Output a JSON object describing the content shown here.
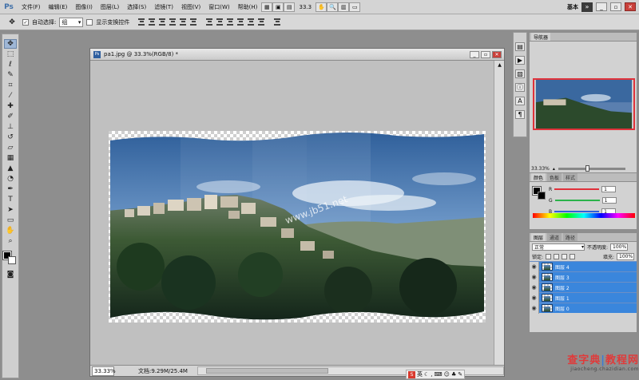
{
  "app": {
    "logo": "Ps"
  },
  "menubar": {
    "items": [
      "文件(F)",
      "编辑(E)",
      "图像(I)",
      "图层(L)",
      "选择(S)",
      "滤镜(T)",
      "视图(V)",
      "窗口(W)",
      "帮助(H)"
    ],
    "zoom": "33.3",
    "workspace": "基本"
  },
  "options": {
    "auto_select_label": "自动选择:",
    "auto_select_value": "组",
    "show_transform_label": "显示变换控件"
  },
  "document": {
    "title": "pa1.jpg @ 33.3%(RGB/8) *",
    "status_zoom": "33.33%",
    "status_info": "文档:9.29M/25.4M",
    "watermark_text": "www.jb51.net"
  },
  "panels": {
    "navigator_tab": "导航器",
    "navigator_zoom": "33.33%",
    "color_tabs": [
      "颜色",
      "色板",
      "样式"
    ],
    "color_channels": [
      {
        "label": "R",
        "value": "1",
        "color": "#e0303a"
      },
      {
        "label": "G",
        "value": "1",
        "color": "#2bb34a"
      },
      {
        "label": "B",
        "value": "1",
        "color": "#2f5fd8"
      }
    ],
    "layers_tabs": [
      "图层",
      "通道",
      "路径"
    ],
    "blend_mode": "正常",
    "opacity_label": "不透明度:",
    "opacity_value": "100%",
    "lock_label": "锁定:",
    "fill_label": "填充:",
    "fill_value": "100%",
    "layers": [
      "图层 4",
      "图层 3",
      "图层 2",
      "图层 1",
      "图层 0"
    ]
  },
  "taskbar": {
    "ime_lang": "英"
  },
  "site_watermark": {
    "main_left": "查字典",
    "main_right": "教程网",
    "sub": "jiaocheng.chazidian.com"
  },
  "colors": {
    "accent_blue": "#3a86dc",
    "nav_frame": "#e0333b",
    "brand_red": "#e03a3a"
  }
}
